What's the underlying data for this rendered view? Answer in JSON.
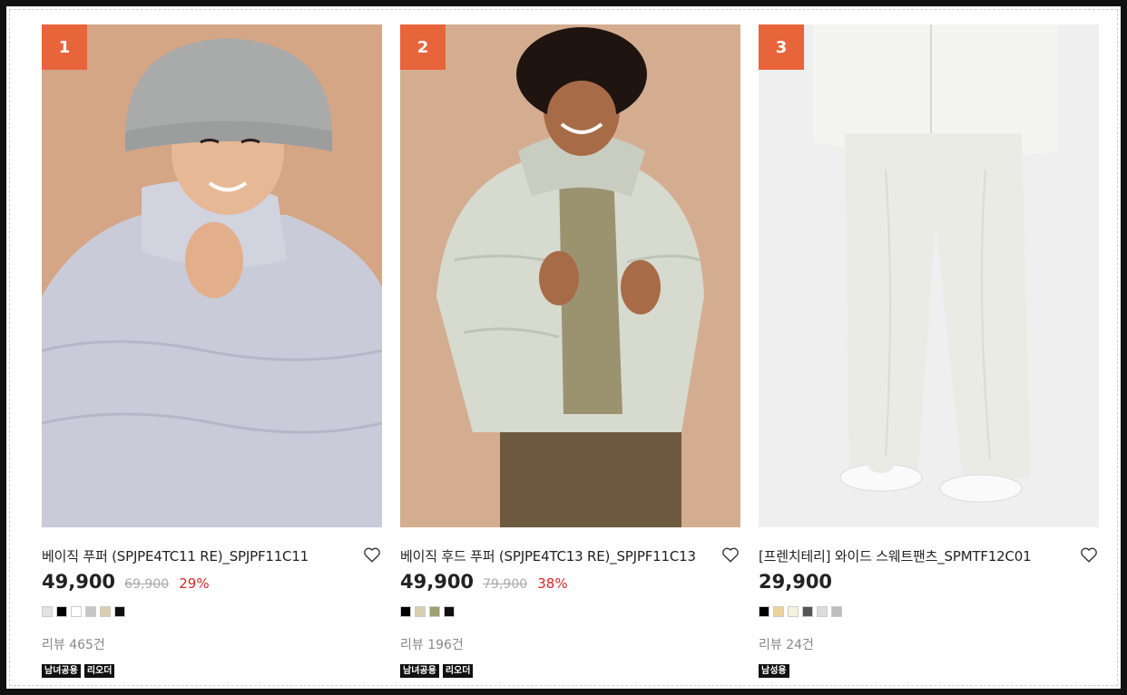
{
  "products": [
    {
      "rank": "1",
      "name": "베이직 푸퍼 (SPJPE4TC11 RE)_SPJPF11C11",
      "price": "49,900",
      "original_price": "69,900",
      "discount": "29%",
      "colors": [
        "#e2e2e2",
        "#000000",
        "#ffffff",
        "#c6c6c6",
        "#d8cfae",
        "#111111"
      ],
      "review": "리뷰 465건",
      "tags": [
        "남녀공용",
        "리오더"
      ],
      "image_bg": "#d4a685"
    },
    {
      "rank": "2",
      "name": "베이직 후드 푸퍼 (SPJPE4TC13 RE)_SPJPF11C13",
      "price": "49,900",
      "original_price": "79,900",
      "discount": "38%",
      "colors": [
        "#000000",
        "#d8cfae",
        "#9da070",
        "#111111"
      ],
      "review": "리뷰 196건",
      "tags": [
        "남녀공용",
        "리오더"
      ],
      "image_bg": "#d4ad91"
    },
    {
      "rank": "3",
      "name": "[프렌치테리] 와이드 스웨트팬츠_SPMTF12C01",
      "price": "29,900",
      "original_price": "",
      "discount": "",
      "colors": [
        "#000000",
        "#efd29b",
        "#f5f2dc",
        "#555555",
        "#dcdcdc",
        "#bdbdbd"
      ],
      "review": "리뷰 24건",
      "tags": [
        "남성용"
      ],
      "image_bg": "#efefef"
    }
  ],
  "accent_color": "#e8643a",
  "discount_color": "#d6262b"
}
